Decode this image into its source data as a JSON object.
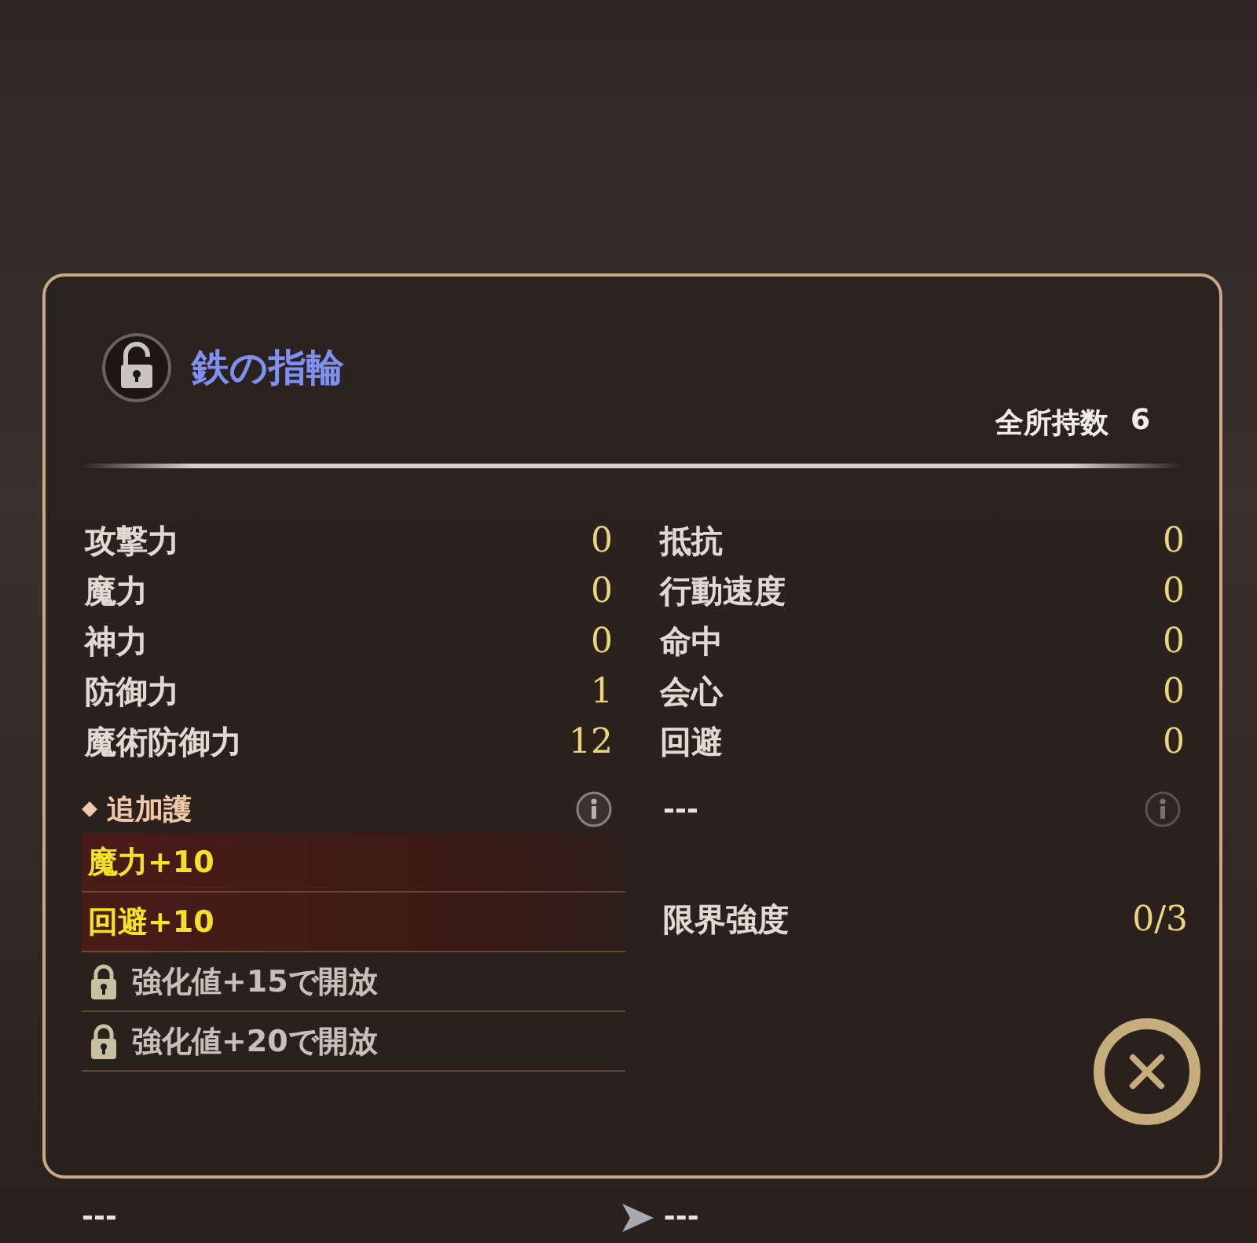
{
  "item": {
    "name": "鉄の指輪",
    "locked": false
  },
  "owned": {
    "label": "全所持数",
    "value": "6"
  },
  "stats_left": [
    {
      "label": "攻撃力",
      "value": "0"
    },
    {
      "label": "魔力",
      "value": "0"
    },
    {
      "label": "神力",
      "value": "0"
    },
    {
      "label": "防御力",
      "value": "1"
    },
    {
      "label": "魔術防御力",
      "value": "12"
    }
  ],
  "stats_right": [
    {
      "label": "抵抗",
      "value": "0"
    },
    {
      "label": "行動速度",
      "value": "0"
    },
    {
      "label": "命中",
      "value": "0"
    },
    {
      "label": "会心",
      "value": "0"
    },
    {
      "label": "回避",
      "value": "0"
    }
  ],
  "extra": {
    "title": "追加護",
    "effects": [
      {
        "text": "魔力+10",
        "locked": false
      },
      {
        "text": "回避+10",
        "locked": false
      },
      {
        "text": "強化値+15で開放",
        "locked": true
      },
      {
        "text": "強化値+20で開放",
        "locked": true
      }
    ]
  },
  "extra_right": "---",
  "limit": {
    "label": "限界強度",
    "value": "0/3"
  },
  "bottom": {
    "left": "---",
    "right": "---"
  }
}
